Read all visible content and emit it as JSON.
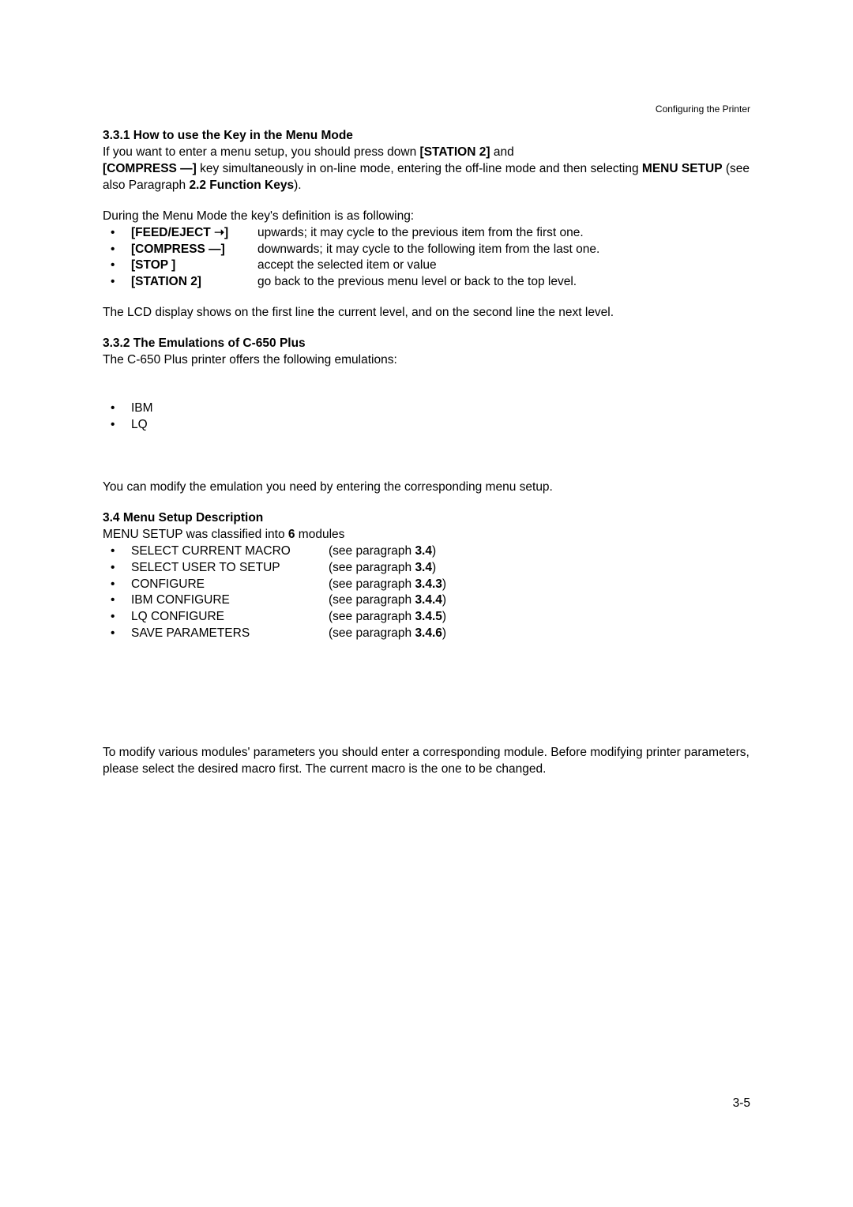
{
  "header": {
    "right": "Configuring the Printer"
  },
  "section_331": {
    "heading": "3.3.1 How to use the Key in the Menu Mode",
    "intro_part1": "If you want to enter a menu setup, you should press down ",
    "intro_key1": "[STATION 2]",
    "intro_part2": " and ",
    "intro_key2": "[COMPRESS —]",
    "intro_part3": " key simultaneously in on-line mode, entering the off-line mode and then selecting ",
    "intro_key3": "MENU SETUP",
    "intro_part4": " (see also Paragraph ",
    "intro_key4": "2.2 Function Keys",
    "intro_part5": ").",
    "during": "During the Menu Mode the key's definition is as following:",
    "keys": [
      {
        "label": "[FEED/EJECT ➝]",
        "desc": "upwards; it may cycle to the previous item from the first one."
      },
      {
        "label": "[COMPRESS —]",
        "desc": "downwards; it may cycle to the following item from the last one."
      },
      {
        "label": "[STOP   ]",
        "desc": "accept the selected item or value"
      },
      {
        "label": "[STATION 2]",
        "desc": "go back to the previous menu level or back to the top level."
      }
    ],
    "lcd": "The LCD display shows on the first line the current level, and on the second line the next level."
  },
  "section_332": {
    "heading": "3.3.2 The Emulations of C-650 Plus",
    "intro": "The C-650 Plus printer offers the following emulations:",
    "items": [
      "IBM",
      "LQ"
    ],
    "closing": "You can modify the emulation you need by entering the corresponding menu setup."
  },
  "section_34": {
    "heading": "3.4    Menu Setup Description",
    "intro_part1": "MENU SETUP was classified into ",
    "intro_bold": "6",
    "intro_part2": " modules",
    "modules": [
      {
        "name": "SELECT CURRENT MACRO",
        "ref_pre": "(see paragraph ",
        "ref_bold": "3.4",
        "ref_post": ")"
      },
      {
        "name": "SELECT USER TO SETUP",
        "ref_pre": "(see paragraph ",
        "ref_bold": "3.4",
        "ref_post": ")"
      },
      {
        "name": "CONFIGURE",
        "ref_pre": "(see paragraph ",
        "ref_bold": "3.4.3",
        "ref_post": ")"
      },
      {
        "name": "IBM CONFIGURE",
        "ref_pre": "(see paragraph ",
        "ref_bold": "3.4.4",
        "ref_post": ")"
      },
      {
        "name": "LQ CONFIGURE",
        "ref_pre": "(see paragraph ",
        "ref_bold": "3.4.5",
        "ref_post": ")"
      },
      {
        "name": "SAVE PARAMETERS",
        "ref_pre": "(see paragraph ",
        "ref_bold": "3.4.6",
        "ref_post": ")"
      }
    ],
    "closing": "To modify various modules' parameters you should enter a corresponding module. Before modifying printer parameters, please select the desired macro first. The current macro is the one to be changed."
  },
  "page_number": "3-5"
}
